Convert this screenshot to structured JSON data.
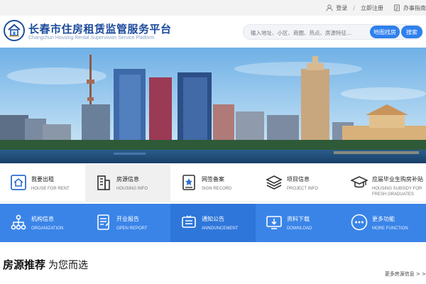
{
  "topbar": {
    "login": "登录",
    "separator": "/",
    "register": "立即注册",
    "guide": "办事指南"
  },
  "header": {
    "title": "长春市住房租赁监管服务平台",
    "subtitle": "Changchun Housing Rental Supervision Service Platform",
    "search_placeholder": "输入地址、小区、商圈、热点、房源特征...",
    "map_button": "地图找房",
    "search_button": "搜索"
  },
  "services_row1": [
    {
      "zh": "我要出租",
      "en": "HOUSE FOR RENT",
      "icon": "house-icon"
    },
    {
      "zh": "房源信息",
      "en": "HOUSING INFO",
      "icon": "building-icon"
    },
    {
      "zh": "网签备案",
      "en": "SIGN RECORD",
      "icon": "sign-document-icon"
    },
    {
      "zh": "项目信息",
      "en": "PROJECT INFO",
      "icon": "layers-icon"
    },
    {
      "zh": "应届毕业生购房补贴",
      "en": "HOUSING SUBSIDY FOR",
      "en2": "FRESH GRADUATES",
      "icon": "graduation-cap-icon"
    }
  ],
  "services_row2": [
    {
      "zh": "机构信息",
      "en": "ORGANIZATION",
      "icon": "org-chart-icon"
    },
    {
      "zh": "开业报告",
      "en": "OPEN REPORT",
      "icon": "report-icon"
    },
    {
      "zh": "通知公告",
      "en": "ANNOUNCEMENT",
      "icon": "bell-icon"
    },
    {
      "zh": "资料下载",
      "en": "DOWNLOAD",
      "icon": "download-icon"
    },
    {
      "zh": "更多功能",
      "en": "MORE FUNCTION",
      "icon": "more-icon"
    }
  ],
  "section": {
    "title_bold": "房源推荐",
    "title_rest": "为您而选",
    "more_link": "更多房源信息 > >"
  },
  "colors": {
    "brand": "#1b4a9a",
    "accent": "#2f80ed",
    "row2_bg": "#3a84e8"
  }
}
